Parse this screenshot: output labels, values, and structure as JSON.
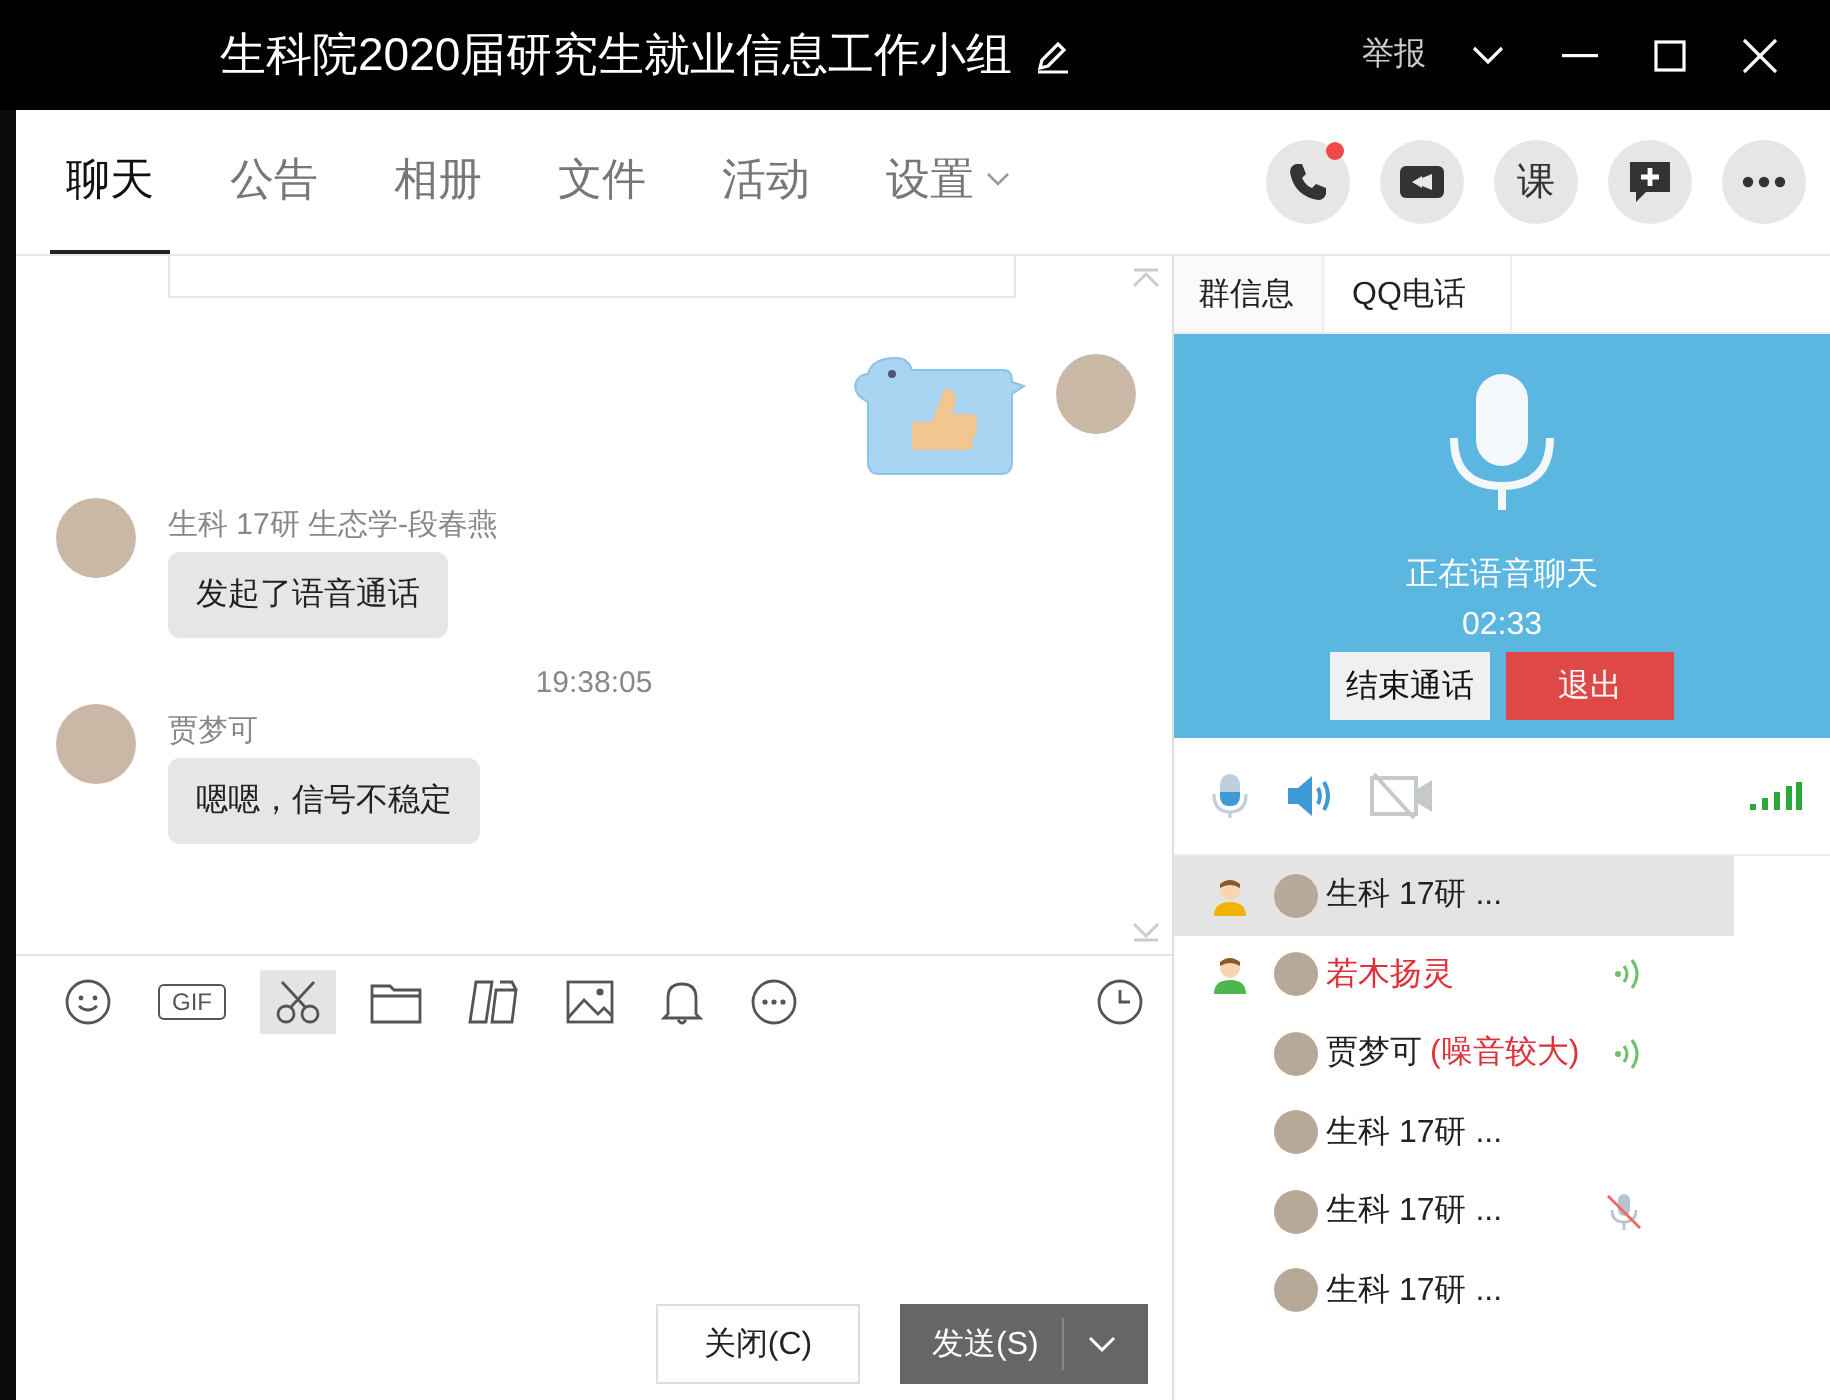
{
  "window": {
    "title": "生科院2020届研究生就业信息工作小组",
    "report": "举报"
  },
  "tabs": [
    {
      "label": "聊天",
      "selected": true,
      "dropdown": false
    },
    {
      "label": "公告",
      "selected": false,
      "dropdown": false
    },
    {
      "label": "相册",
      "selected": false,
      "dropdown": false
    },
    {
      "label": "文件",
      "selected": false,
      "dropdown": false
    },
    {
      "label": "活动",
      "selected": false,
      "dropdown": false
    },
    {
      "label": "设置",
      "selected": false,
      "dropdown": true
    }
  ],
  "call_buttons": [
    {
      "kind": "phone",
      "badge": true
    },
    {
      "kind": "video",
      "badge": false
    },
    {
      "kind": "class",
      "label": "课",
      "badge": false
    },
    {
      "kind": "add",
      "badge": false
    },
    {
      "kind": "more",
      "badge": false
    }
  ],
  "messages": [
    {
      "kind": "sticker"
    },
    {
      "kind": "text",
      "sender": "生科 17研 生态学-段春燕",
      "text": "发起了语音通话"
    },
    {
      "kind": "time",
      "text": "19:38:05"
    },
    {
      "kind": "text",
      "sender": "贾梦可",
      "text": "嗯嗯，信号不稳定"
    }
  ],
  "toolbar": [
    {
      "kind": "emoji",
      "selected": false
    },
    {
      "kind": "gif",
      "label": "GIF",
      "selected": false
    },
    {
      "kind": "scissors",
      "selected": true
    },
    {
      "kind": "folder",
      "selected": false
    },
    {
      "kind": "doc",
      "selected": false
    },
    {
      "kind": "image",
      "selected": false
    },
    {
      "kind": "bell",
      "selected": false
    },
    {
      "kind": "more",
      "selected": false
    }
  ],
  "buttons": {
    "close": "关闭(C)",
    "send": "发送(S)"
  },
  "side_tabs": [
    {
      "label": "群信息",
      "selected": false
    },
    {
      "label": "QQ电话",
      "selected": true
    }
  ],
  "call": {
    "status": "正在语音聊天",
    "duration": "02:33",
    "end": "结束通话",
    "quit": "退出"
  },
  "members": [
    {
      "owner": true,
      "admin": false,
      "name": "生科 17研 ...",
      "highlight": false,
      "speaking": false,
      "muted": false,
      "selected": true
    },
    {
      "owner": false,
      "admin": true,
      "name": "若木扬灵",
      "highlight": true,
      "speaking": true,
      "muted": false,
      "selected": false
    },
    {
      "owner": false,
      "admin": false,
      "name": "贾梦可",
      "note": "(噪音较大)",
      "highlight": false,
      "speaking": true,
      "muted": false,
      "selected": false
    },
    {
      "owner": false,
      "admin": false,
      "name": "生科 17研 ...",
      "highlight": false,
      "speaking": false,
      "muted": false,
      "selected": false
    },
    {
      "owner": false,
      "admin": false,
      "name": "生科 17研 ...",
      "highlight": false,
      "speaking": false,
      "muted": true,
      "selected": false
    },
    {
      "owner": false,
      "admin": false,
      "name": "生科 17研 ...",
      "highlight": false,
      "speaking": false,
      "muted": false,
      "selected": false
    }
  ]
}
